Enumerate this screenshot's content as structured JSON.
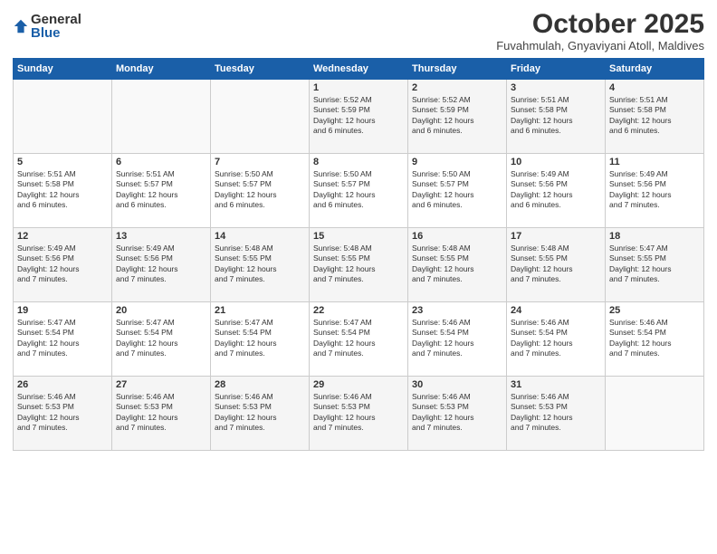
{
  "logo": {
    "general": "General",
    "blue": "Blue"
  },
  "title": "October 2025",
  "location": "Fuvahmulah, Gnyaviyani Atoll, Maldives",
  "headers": [
    "Sunday",
    "Monday",
    "Tuesday",
    "Wednesday",
    "Thursday",
    "Friday",
    "Saturday"
  ],
  "weeks": [
    [
      {
        "day": "",
        "info": ""
      },
      {
        "day": "",
        "info": ""
      },
      {
        "day": "",
        "info": ""
      },
      {
        "day": "1",
        "info": "Sunrise: 5:52 AM\nSunset: 5:59 PM\nDaylight: 12 hours\nand 6 minutes."
      },
      {
        "day": "2",
        "info": "Sunrise: 5:52 AM\nSunset: 5:59 PM\nDaylight: 12 hours\nand 6 minutes."
      },
      {
        "day": "3",
        "info": "Sunrise: 5:51 AM\nSunset: 5:58 PM\nDaylight: 12 hours\nand 6 minutes."
      },
      {
        "day": "4",
        "info": "Sunrise: 5:51 AM\nSunset: 5:58 PM\nDaylight: 12 hours\nand 6 minutes."
      }
    ],
    [
      {
        "day": "5",
        "info": "Sunrise: 5:51 AM\nSunset: 5:58 PM\nDaylight: 12 hours\nand 6 minutes."
      },
      {
        "day": "6",
        "info": "Sunrise: 5:51 AM\nSunset: 5:57 PM\nDaylight: 12 hours\nand 6 minutes."
      },
      {
        "day": "7",
        "info": "Sunrise: 5:50 AM\nSunset: 5:57 PM\nDaylight: 12 hours\nand 6 minutes."
      },
      {
        "day": "8",
        "info": "Sunrise: 5:50 AM\nSunset: 5:57 PM\nDaylight: 12 hours\nand 6 minutes."
      },
      {
        "day": "9",
        "info": "Sunrise: 5:50 AM\nSunset: 5:57 PM\nDaylight: 12 hours\nand 6 minutes."
      },
      {
        "day": "10",
        "info": "Sunrise: 5:49 AM\nSunset: 5:56 PM\nDaylight: 12 hours\nand 6 minutes."
      },
      {
        "day": "11",
        "info": "Sunrise: 5:49 AM\nSunset: 5:56 PM\nDaylight: 12 hours\nand 7 minutes."
      }
    ],
    [
      {
        "day": "12",
        "info": "Sunrise: 5:49 AM\nSunset: 5:56 PM\nDaylight: 12 hours\nand 7 minutes."
      },
      {
        "day": "13",
        "info": "Sunrise: 5:49 AM\nSunset: 5:56 PM\nDaylight: 12 hours\nand 7 minutes."
      },
      {
        "day": "14",
        "info": "Sunrise: 5:48 AM\nSunset: 5:55 PM\nDaylight: 12 hours\nand 7 minutes."
      },
      {
        "day": "15",
        "info": "Sunrise: 5:48 AM\nSunset: 5:55 PM\nDaylight: 12 hours\nand 7 minutes."
      },
      {
        "day": "16",
        "info": "Sunrise: 5:48 AM\nSunset: 5:55 PM\nDaylight: 12 hours\nand 7 minutes."
      },
      {
        "day": "17",
        "info": "Sunrise: 5:48 AM\nSunset: 5:55 PM\nDaylight: 12 hours\nand 7 minutes."
      },
      {
        "day": "18",
        "info": "Sunrise: 5:47 AM\nSunset: 5:55 PM\nDaylight: 12 hours\nand 7 minutes."
      }
    ],
    [
      {
        "day": "19",
        "info": "Sunrise: 5:47 AM\nSunset: 5:54 PM\nDaylight: 12 hours\nand 7 minutes."
      },
      {
        "day": "20",
        "info": "Sunrise: 5:47 AM\nSunset: 5:54 PM\nDaylight: 12 hours\nand 7 minutes."
      },
      {
        "day": "21",
        "info": "Sunrise: 5:47 AM\nSunset: 5:54 PM\nDaylight: 12 hours\nand 7 minutes."
      },
      {
        "day": "22",
        "info": "Sunrise: 5:47 AM\nSunset: 5:54 PM\nDaylight: 12 hours\nand 7 minutes."
      },
      {
        "day": "23",
        "info": "Sunrise: 5:46 AM\nSunset: 5:54 PM\nDaylight: 12 hours\nand 7 minutes."
      },
      {
        "day": "24",
        "info": "Sunrise: 5:46 AM\nSunset: 5:54 PM\nDaylight: 12 hours\nand 7 minutes."
      },
      {
        "day": "25",
        "info": "Sunrise: 5:46 AM\nSunset: 5:54 PM\nDaylight: 12 hours\nand 7 minutes."
      }
    ],
    [
      {
        "day": "26",
        "info": "Sunrise: 5:46 AM\nSunset: 5:53 PM\nDaylight: 12 hours\nand 7 minutes."
      },
      {
        "day": "27",
        "info": "Sunrise: 5:46 AM\nSunset: 5:53 PM\nDaylight: 12 hours\nand 7 minutes."
      },
      {
        "day": "28",
        "info": "Sunrise: 5:46 AM\nSunset: 5:53 PM\nDaylight: 12 hours\nand 7 minutes."
      },
      {
        "day": "29",
        "info": "Sunrise: 5:46 AM\nSunset: 5:53 PM\nDaylight: 12 hours\nand 7 minutes."
      },
      {
        "day": "30",
        "info": "Sunrise: 5:46 AM\nSunset: 5:53 PM\nDaylight: 12 hours\nand 7 minutes."
      },
      {
        "day": "31",
        "info": "Sunrise: 5:46 AM\nSunset: 5:53 PM\nDaylight: 12 hours\nand 7 minutes."
      },
      {
        "day": "",
        "info": ""
      }
    ]
  ]
}
